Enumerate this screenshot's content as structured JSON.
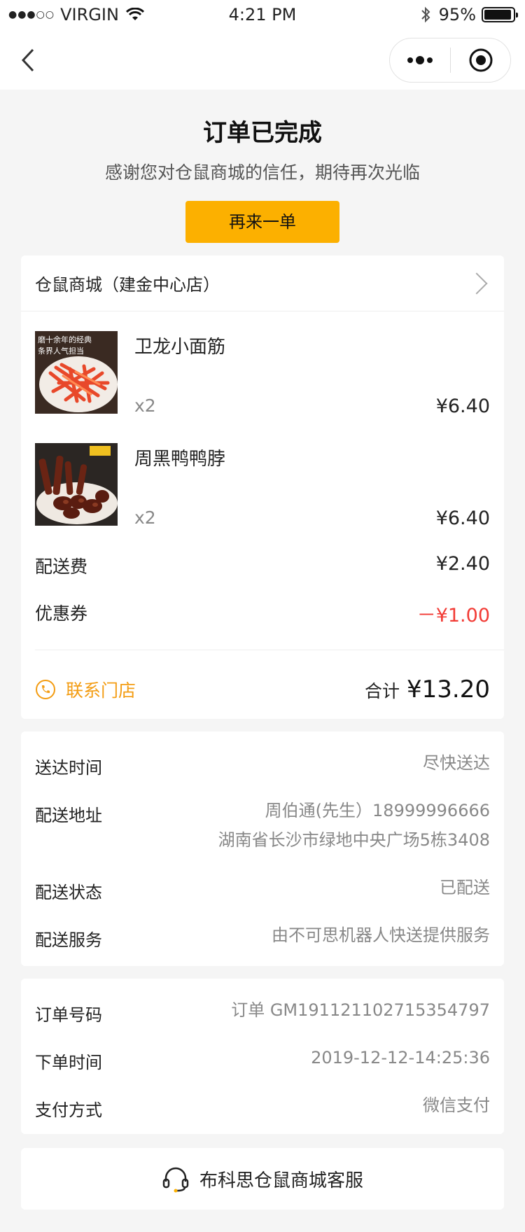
{
  "status_bar": {
    "carrier": "VIRGIN",
    "time": "4:21 PM",
    "battery_percent": "95%",
    "battery_level": 0.95
  },
  "nav": {
    "back_icon": "chevron-left-icon",
    "more_icon": "more-dots-icon",
    "close_icon": "target-close-icon"
  },
  "header": {
    "title": "订单已完成",
    "subtitle": "感谢您对仓鼠商城的信任，期待再次光临",
    "reorder_label": "再来一单",
    "accent_color": "#fcb000"
  },
  "order": {
    "store_name": "仓鼠商城（建金中心店）",
    "products": [
      {
        "name": "卫龙小面筋",
        "qty": "x2",
        "price": "¥6.40",
        "thumb_caption_1": "磨十余年的经典",
        "thumb_caption_2": "条界人气担当"
      },
      {
        "name": "周黑鸭鸭脖",
        "qty": "x2",
        "price": "¥6.40"
      }
    ],
    "delivery_fee_label": "配送费",
    "delivery_fee": "¥2.40",
    "coupon_label": "优惠券",
    "coupon_value": "－¥1.00",
    "coupon_color": "#f23b35",
    "contact_label": "联系门店",
    "total_label": "合计",
    "total_value": "¥13.20"
  },
  "delivery": {
    "rows": [
      {
        "label": "送达时间",
        "value": "尽快送达"
      },
      {
        "label": "配送地址",
        "value": "周伯通(先生）18999996666",
        "value2": "湖南省长沙市绿地中央广场5栋3408"
      },
      {
        "label": "配送状态",
        "value": "已配送"
      },
      {
        "label": "配送服务",
        "value": "由不可思机器人快送提供服务"
      }
    ]
  },
  "payment": {
    "rows": [
      {
        "label": "订单号码",
        "value": "订单 GM191121102715354797"
      },
      {
        "label": "下单时间",
        "value": "2019-12-12-14:25:36"
      },
      {
        "label": "支付方式",
        "value": "微信支付"
      }
    ]
  },
  "service": {
    "label": "布科思仓鼠商城客服",
    "icon": "headset-icon"
  }
}
